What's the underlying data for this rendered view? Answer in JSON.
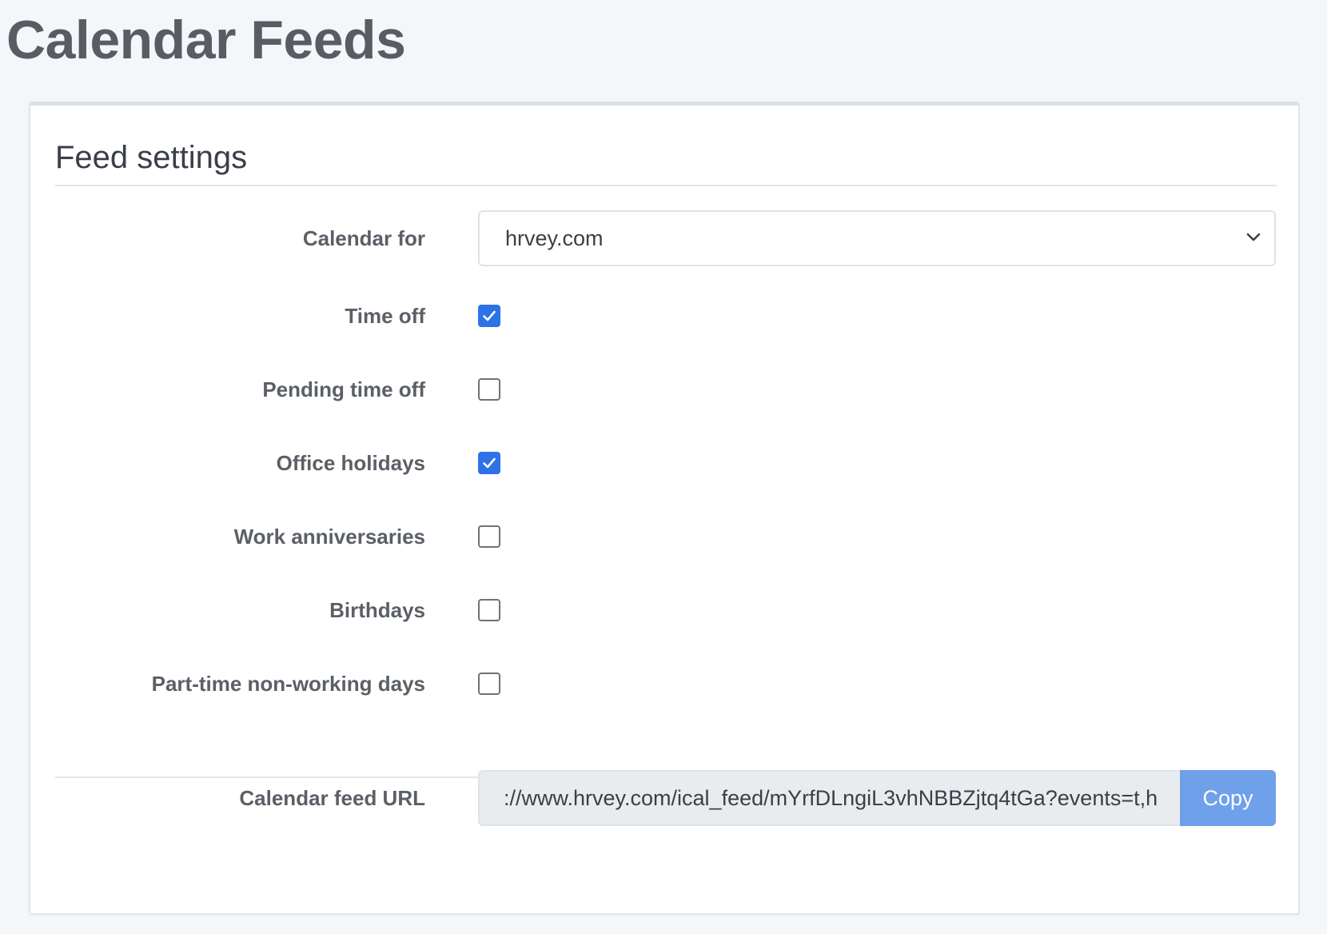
{
  "page": {
    "title": "Calendar Feeds"
  },
  "card": {
    "title": "Feed settings"
  },
  "calendar_for": {
    "label": "Calendar for",
    "selected": "hrvey.com",
    "icon": "chevron-down-icon"
  },
  "options": [
    {
      "label": "Time off",
      "checked": true
    },
    {
      "label": "Pending time off",
      "checked": false
    },
    {
      "label": "Office holidays",
      "checked": true
    },
    {
      "label": "Work anniversaries",
      "checked": false
    },
    {
      "label": "Birthdays",
      "checked": false
    },
    {
      "label": "Part-time non-working days",
      "checked": false
    }
  ],
  "feed_url": {
    "label": "Calendar feed URL",
    "value": "://www.hrvey.com/ical_feed/mYrfDLngiL3vhNBBZjtq4tGa?events=t,h",
    "copy_label": "Copy"
  },
  "colors": {
    "checkbox_checked": "#2d72e6",
    "copy_button": "#6fa0ea",
    "page_bg": "#f5f6f9"
  }
}
